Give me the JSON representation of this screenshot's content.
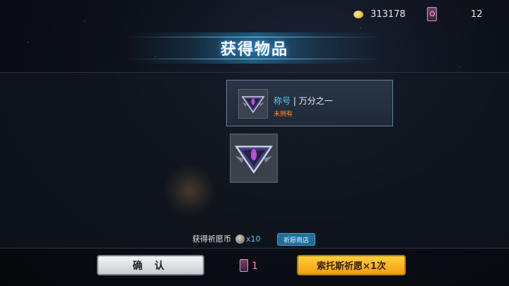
{
  "currency": {
    "coins": "313178",
    "wish_tickets": "12"
  },
  "banner": {
    "title": "获得物品"
  },
  "item": {
    "type_label": "称号",
    "separator": " | ",
    "name": "万分之一",
    "status": "未拥有",
    "status_color": "#ff8a1e"
  },
  "reward": {
    "label": "获得祈愿币",
    "quantity": "x10",
    "shop_button": "祈愿商店"
  },
  "footer": {
    "confirm_label": "确 认",
    "ticket_cost": "1",
    "wish_button": "索托斯祈愿×1次"
  },
  "icons": {
    "coin": "gold-coin-icon",
    "ticket": "wish-ticket-icon",
    "badge": "title-badge-icon",
    "wish_coin": "wish-coin-icon"
  }
}
